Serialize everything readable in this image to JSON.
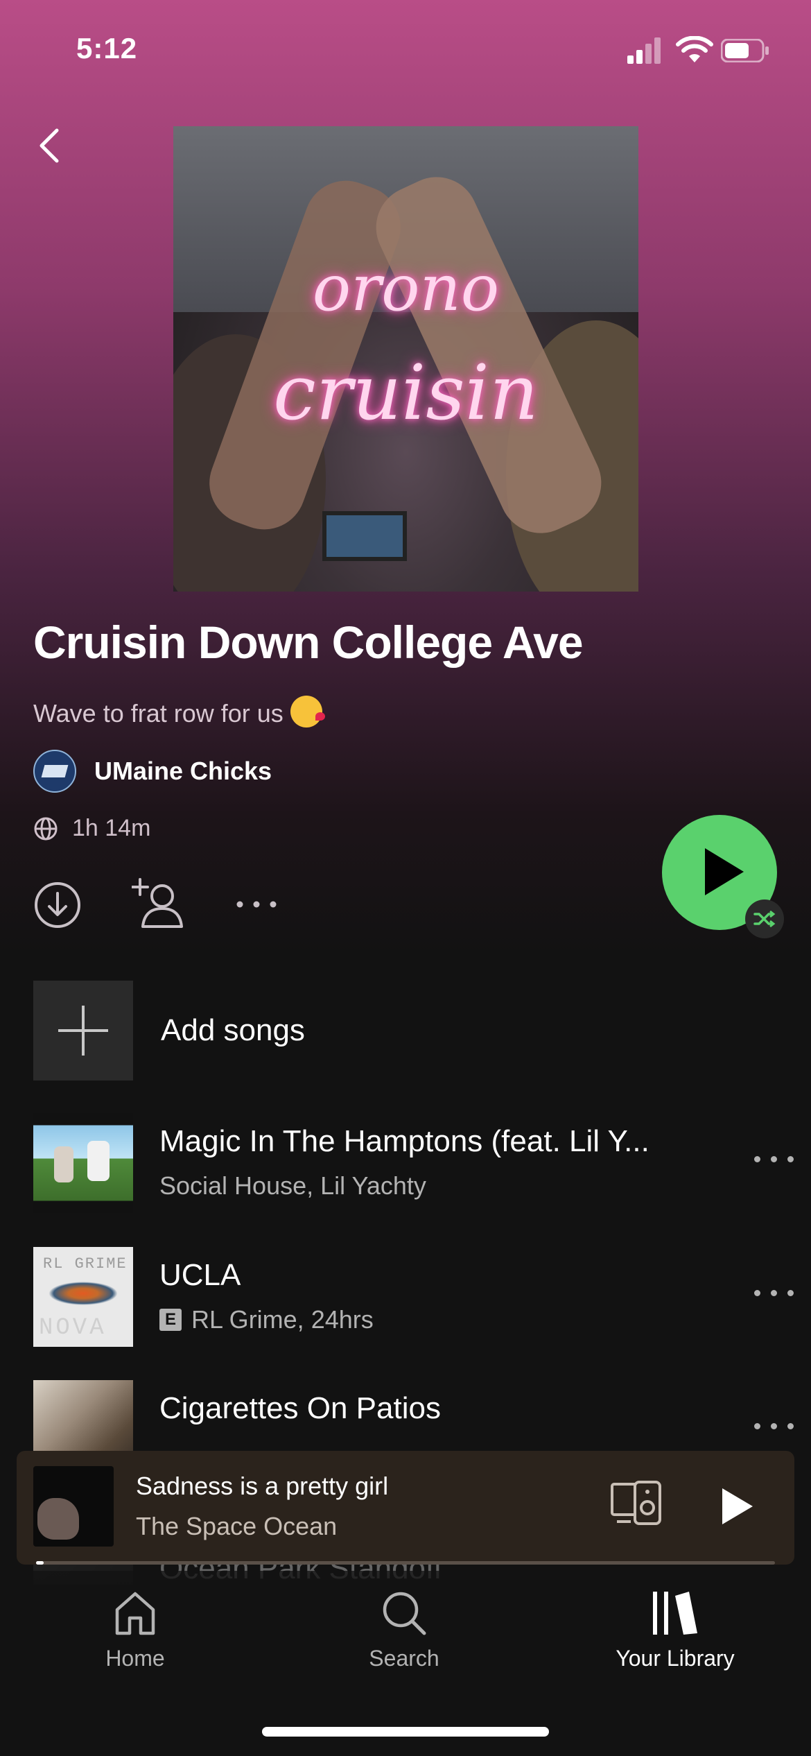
{
  "status_bar": {
    "time": "5:12"
  },
  "playlist": {
    "cover_text_line1": "orono",
    "cover_text_line2": "cruisin",
    "title": "Cruisin Down College Ave",
    "description": "Wave to frat row for us",
    "owner": "UMaine Chicks",
    "duration": "1h 14m"
  },
  "colors": {
    "accent": "#5ad16d",
    "hero_top": "#b94d87",
    "background": "#121212"
  },
  "add_songs_label": "Add songs",
  "tracks": [
    {
      "title": "Magic In The Hamptons (feat. Lil Y...",
      "artist": "Social House, Lil Yachty",
      "explicit": false
    },
    {
      "title": "UCLA",
      "artist": "RL Grime, 24hrs",
      "explicit": true,
      "explicit_badge": "E",
      "art_text_top": "RL GRIME",
      "art_text_bottom": "NOVA"
    },
    {
      "title": "Cigarettes On Patios",
      "artist": "",
      "explicit": true
    },
    {
      "title": "Ocean Park Standoff",
      "artist": "",
      "explicit": false
    }
  ],
  "now_playing": {
    "title": "Sadness is a pretty girl",
    "artist": "The Space Ocean",
    "progress": 0.01
  },
  "tabs": [
    {
      "label": "Home",
      "icon": "home-icon"
    },
    {
      "label": "Search",
      "icon": "search-icon"
    },
    {
      "label": "Your Library",
      "icon": "library-icon",
      "active": true
    }
  ]
}
